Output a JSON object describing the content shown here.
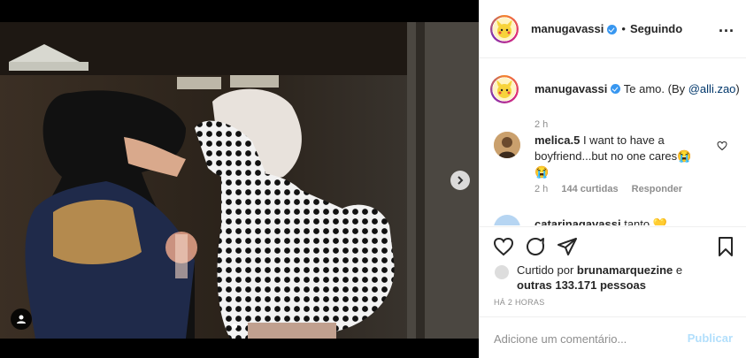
{
  "post": {
    "author": "manugavassi",
    "following_label": "Seguindo",
    "dot": "•",
    "more_label": "..."
  },
  "caption": {
    "username": "manugavassi",
    "text": "Te amo. (By ",
    "mention": "@alli.zao",
    "text_end": ")",
    "time": "2 h"
  },
  "comments": [
    {
      "username": "melica.5",
      "text": "I want to have a boyfriend...but no one cares😭",
      "extra_emoji": "😭",
      "time": "2 h",
      "likes": "144 curtidas",
      "reply": "Responder"
    },
    {
      "username": "catarinagavassi",
      "text": "tanto 💛"
    }
  ],
  "likes": {
    "prefix": "Curtido por ",
    "user": "brunamarquezine",
    "middle": " e",
    "others": "outras 133.171 pessoas"
  },
  "posted": "HÁ 2 HORAS",
  "add_comment": {
    "placeholder": "Adicione um comentário...",
    "publish_label": "Publicar"
  },
  "colors": {
    "accent": "#3897f0",
    "publish_disabled": "#b2dffc",
    "meta": "#8e8e8e"
  },
  "icons": {
    "like": "heart-icon",
    "comment": "comment-icon",
    "share": "share-icon",
    "save": "bookmark-icon",
    "next": "chevron-right-icon",
    "tag": "user-tag-icon"
  },
  "carousel": {
    "count": 2,
    "active_index": 0
  }
}
